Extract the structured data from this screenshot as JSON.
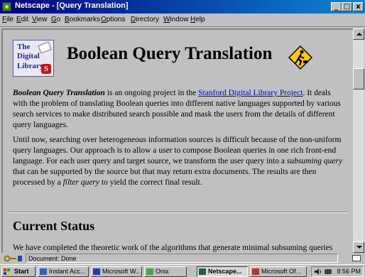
{
  "window": {
    "title": "Netscape - [Query Translation]",
    "controls": {
      "minimize": "_",
      "maximize": "□",
      "close": "x"
    }
  },
  "menu": [
    {
      "label": "File",
      "u": "F",
      "rest": "ile"
    },
    {
      "label": "Edit",
      "u": "E",
      "rest": "dit"
    },
    {
      "label": "View",
      "u": "V",
      "rest": "iew"
    },
    {
      "label": "Go",
      "u": "G",
      "rest": "o"
    },
    {
      "label": "Bookmarks",
      "u": "B",
      "rest": "ookmarks"
    },
    {
      "label": "Options",
      "u": "O",
      "rest": "ptions"
    },
    {
      "label": "Directory",
      "u": "D",
      "rest": "irectory"
    },
    {
      "label": "Window",
      "u": "W",
      "rest": "indow"
    },
    {
      "label": "Help",
      "u": "H",
      "rest": "elp"
    }
  ],
  "page": {
    "logo": {
      "line1": "The",
      "line2": "Digital",
      "line3": "Library",
      "mark": "S"
    },
    "title": "Boolean Query Translation",
    "p1": {
      "lead": "Boolean Query Translation",
      "text1": " is an ongoing project in the ",
      "link": "Stanford Digital Library Project",
      "text2": ". It deals with the problem of translating Boolean queries into different native languages supported by various search services to make distributed search possible and mask the users from the details of different query languages."
    },
    "p2": {
      "text1": "Until now, searching over heterogeneous information sources is difficult because of the non-uniform query languages. Our approach is to allow a user to compose Boolean queries in one rich front-end language. For each user query and target source, we transform the user query into a ",
      "em1": "subsuming query",
      "text2": " that can be supported by the source but that may return extra documents. The results are then processed by a ",
      "em2": "filter query",
      "text3": " to yield the correct final result."
    },
    "section_title": "Current Status",
    "p3": "We have completed the theoretic work of the algorithms that generate minimal subsuming queries"
  },
  "status": {
    "text": "Document: Done"
  },
  "taskbar": {
    "start": "Start",
    "tasks": [
      {
        "label": "Instant Acc...",
        "active": false
      },
      {
        "label": "Microsoft W...",
        "active": false
      },
      {
        "label": "Onix",
        "active": false
      },
      {
        "label": "Netscape...",
        "active": true
      },
      {
        "label": "Microsoft Of...",
        "active": false
      }
    ],
    "clock": "8:56 PM"
  },
  "colors": {
    "titlebar": "#000080",
    "link": "#0000ee",
    "face": "#c0c0c0"
  }
}
